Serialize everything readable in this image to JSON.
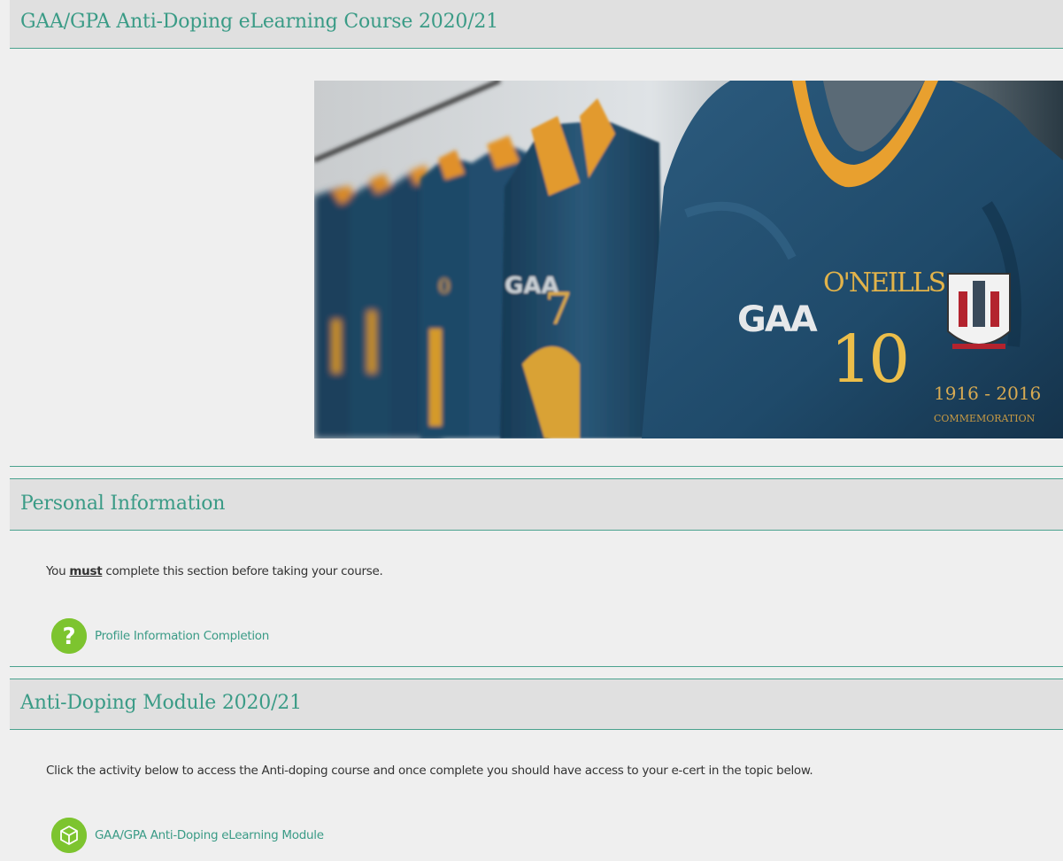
{
  "course": {
    "title": "GAA/GPA Anti-Doping eLearning Course 2020/21",
    "banner_image": "gaa-jerseys-banner",
    "banner_text": {
      "gaa": "GAA",
      "brand": "O'NEILLS",
      "number": "10",
      "years": "1916 - 2016",
      "commemoration": "COMMEMORATION"
    }
  },
  "sections": [
    {
      "title": "Personal Information",
      "summary_pre": "You ",
      "summary_emph": "must",
      "summary_post": " complete this section before taking your course.",
      "activity": {
        "label": "Profile Information Completion",
        "icon": "question-icon"
      }
    },
    {
      "title": "Anti-Doping Module 2020/21",
      "summary": "Click the activity below to access the Anti-doping course and once complete you should have access to your e-cert in the topic below.",
      "activity": {
        "label": "GAA/GPA Anti-Doping eLearning Module",
        "icon": "scorm-package-icon"
      }
    }
  ],
  "colors": {
    "accent": "#3a9b86",
    "header_bg": "#e0e0e0",
    "page_bg": "#efefef",
    "icon_green": "#7dc42f",
    "jersey_blue": "#1f4a6a",
    "jersey_orange": "#e09a2a"
  }
}
